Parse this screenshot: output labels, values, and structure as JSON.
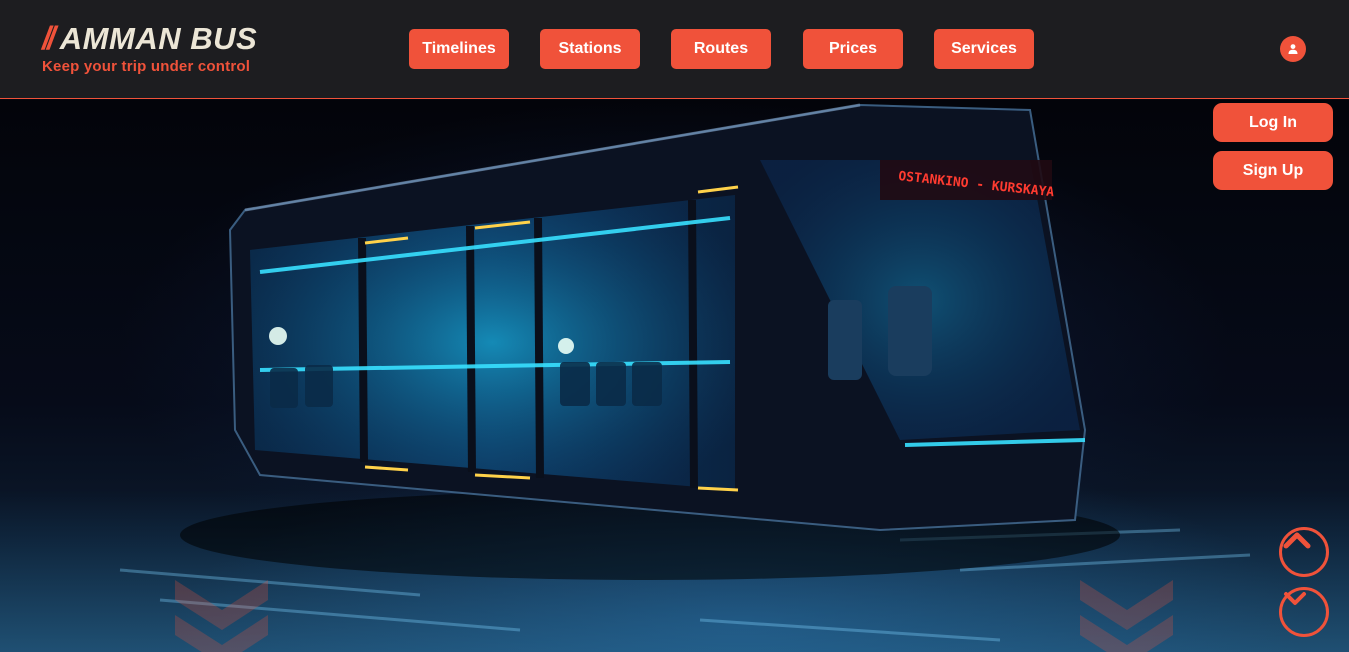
{
  "brand": {
    "slash": "//",
    "title": "AMMAN BUS",
    "tagline": "Keep your trip under control"
  },
  "nav": {
    "items": [
      {
        "label": "Timelines"
      },
      {
        "label": "Stations"
      },
      {
        "label": "Routes"
      },
      {
        "label": "Prices"
      },
      {
        "label": "Services"
      }
    ]
  },
  "user_menu": {
    "icon": "user-icon"
  },
  "auth": {
    "login_label": "Log In",
    "signup_label": "Sign Up"
  },
  "hero": {
    "bus_sign": "OSTANKINO - KURSKAYA",
    "scroll_up_icon": "chevron-up-icon",
    "scroll_down_icon": "chevron-down-icon"
  },
  "colors": {
    "accent": "#f0523a",
    "header_bg": "#1d1d20",
    "logo_text": "#ece6d6"
  }
}
